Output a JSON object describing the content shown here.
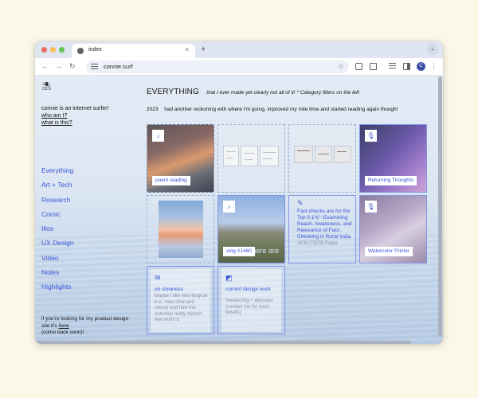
{
  "browser": {
    "tab_title": "index",
    "url": "connie.surf",
    "profile_initial": "C",
    "icons": [
      "back-icon",
      "forward-icon",
      "reload-icon",
      "site-info-icon",
      "bookmark-star-icon",
      "menu-icon"
    ]
  },
  "sidebar": {
    "logo_icon": "umbrella-icon",
    "logo_glyph": "⛱",
    "intro": "connie is an internet surfer!",
    "who_link": "who am I?",
    "what_link": "what is this?",
    "nav": [
      "Everything",
      "Art + Tech",
      "Research",
      "Comic",
      "Illos",
      "UX Design",
      "Video",
      "Notes",
      "Highlights"
    ],
    "footer_text": "if you're looking for my product design site it's",
    "footer_link": "here",
    "footer_after": "(come back soon)!"
  },
  "main": {
    "title": "EVERYTHING",
    "subtitle": "that I ever made yet clearly not all of it! * Category filters on the left",
    "update_year": "2023",
    "update_text": "had another reckoning with where I'm going, improved my mile time and started reading again though!",
    "cards": [
      {
        "label": "poem reading",
        "badge_icon": "music-note-icon",
        "badge": "♪"
      },
      {
        "label": "",
        "badge_icon": ""
      },
      {
        "label": "",
        "badge_icon": ""
      },
      {
        "label": "Returning Thoughts",
        "badge_icon": "microphone-icon",
        "badge": "🎙"
      },
      {
        "label": "",
        "badge_icon": ""
      },
      {
        "label": "vlog #1460",
        "badge_icon": "music-note-icon",
        "badge": "♪",
        "overlay_text": "where are"
      },
      {
        "icon_name": "pencil-icon",
        "icon": "✎",
        "title": "Fact-checks are for the Top 0.1%\": Examining Reach, Awareness, and Relevance of Fact-Checking in Rural India",
        "subtitle": "ACM CSCW Paper"
      },
      {
        "label": "Watercolor Printer",
        "badge_icon": "microphone-icon",
        "badge": "🎙"
      },
      {
        "icon_name": "envelope-icon",
        "icon": "✉",
        "title": "on slowness",
        "subtitle": "Maybe I like how illogical it is. How slow and messy and how the outcome really doesn't feel worth it."
      },
      {
        "icon_name": "contrast-square-icon",
        "icon": "◩",
        "title": "current design work",
        "subtitle": "freelancing + atlassian (contact me for more details)"
      }
    ]
  },
  "colors": {
    "link_blue": "#3a55d8",
    "background": "#fcf8e8",
    "card_border": "#7f95e8"
  }
}
